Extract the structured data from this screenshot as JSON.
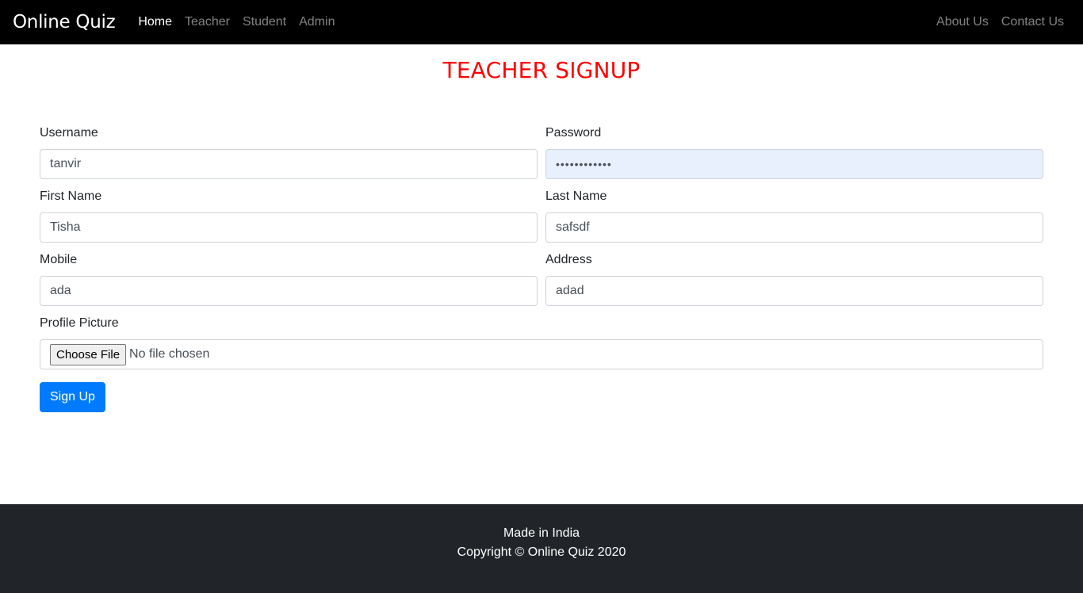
{
  "navbar": {
    "brand": "Online Quiz",
    "left_links": [
      {
        "label": "Home",
        "active": true
      },
      {
        "label": "Teacher",
        "active": false
      },
      {
        "label": "Student",
        "active": false
      },
      {
        "label": "Admin",
        "active": false
      }
    ],
    "right_links": [
      {
        "label": "About Us"
      },
      {
        "label": "Contact Us"
      }
    ]
  },
  "page": {
    "title": "TEACHER SIGNUP"
  },
  "form": {
    "username": {
      "label": "Username",
      "value": "tanvir"
    },
    "password": {
      "label": "Password",
      "value": "••••••••••••"
    },
    "first_name": {
      "label": "First Name",
      "value": "Tisha"
    },
    "last_name": {
      "label": "Last Name",
      "value": "safsdf"
    },
    "mobile": {
      "label": "Mobile",
      "value": "ada"
    },
    "address": {
      "label": "Address",
      "value": "adad"
    },
    "profile_picture": {
      "label": "Profile Picture",
      "button_label": "Choose File",
      "status": "No file chosen"
    },
    "submit_label": "Sign Up"
  },
  "footer": {
    "line1": "Made in India",
    "line2": "Copyright © Online Quiz 2020"
  },
  "colors": {
    "navbar_bg": "#000000",
    "title": "#ff0000",
    "primary": "#007bff",
    "footer_bg": "#212529",
    "autofill_bg": "#e8f0fe"
  }
}
